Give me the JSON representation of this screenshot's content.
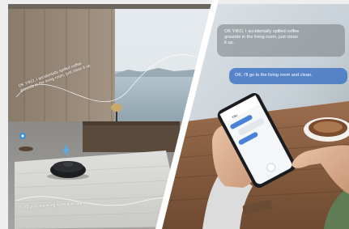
{
  "left_scene": {
    "spoken_line_1": "OK YIKO, I accidentally spilled coffee\ngrounds in the living room, just clean it up.",
    "spoken_line_2": "OK, I'll go to the living room and clean."
  },
  "right_scene": {
    "bubble_user": "OK YIKO, I accidentally spilled coffee\ngrounds in the living room, just clean\nit up.",
    "bubble_reply": "OK, I'll go to the living room and clean.",
    "phone_app_title": "Yiko"
  },
  "colors": {
    "bubble_reply_bg": "#3a70c4",
    "bubble_user_bg": "#7d8287",
    "glass_gradient_a": "#33c6d8",
    "glass_gradient_b": "#7b6fe0"
  }
}
